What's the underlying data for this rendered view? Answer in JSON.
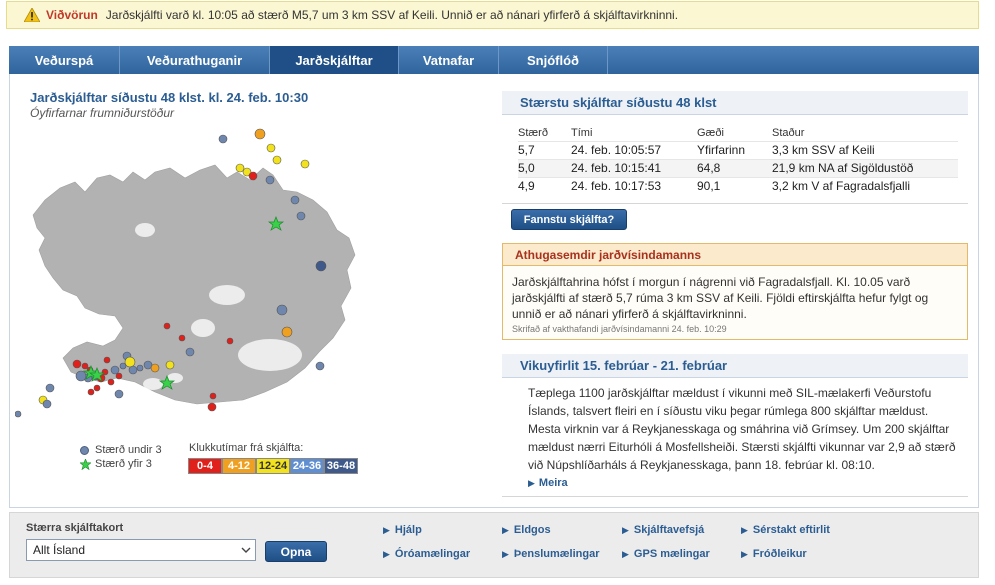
{
  "alert": {
    "label": "Viðvörun",
    "text": "Jarðskjálfti varð kl. 10:05 að stærð M5,7 um 3 km SSV af Keili. Unnið er að nánari yfirferð á skjálftavirkninni."
  },
  "tabs": [
    {
      "label": "Veðurspá",
      "active": false
    },
    {
      "label": "Veðurathuganir",
      "active": false
    },
    {
      "label": "Jarðskjálftar",
      "active": true
    },
    {
      "label": "Vatnafar",
      "active": false
    },
    {
      "label": "Snjóflóð",
      "active": false
    }
  ],
  "map": {
    "title": "Jarðskjálftar síðustu 48 klst.  kl. 24. feb. 10:30",
    "subtitle": "Óyfirfarnar frumniðurstöður",
    "legend": {
      "small_label": "Stærð undir 3",
      "large_label": "Stærð yfir 3",
      "clock_label": "Klukkutímar frá skjálfta:",
      "bins": [
        {
          "label": "0-4",
          "color": "#e0201a"
        },
        {
          "label": "4-12",
          "color": "#f0a020"
        },
        {
          "label": "12-24",
          "color": "#f2e21e"
        },
        {
          "label": "24-36",
          "color": "#5f8fd0"
        },
        {
          "label": "36-48",
          "color": "#3f5a8a"
        }
      ]
    }
  },
  "largest": {
    "title": "Stærstu skjálftar síðustu 48 klst",
    "headers": [
      "Stærð",
      "Tími",
      "Gæði",
      "Staður"
    ],
    "rows": [
      [
        "5,7",
        "24. feb. 10:05:57",
        "Yfirfarinn",
        "3,3 km SSV af Keili"
      ],
      [
        "5,0",
        "24. feb. 10:15:41",
        "64,8",
        "21,9 km NA af Sigöldustöð"
      ],
      [
        "4,9",
        "24. feb. 10:17:53",
        "90,1",
        "3,2 km V af Fagradalsfjalli"
      ]
    ],
    "felt_button": "Fannstu skjálfta?"
  },
  "note": {
    "title": "Athugasemdir jarðvísindamanns",
    "text": "Jarðskjálftahrina hófst í morgun í nágrenni við Fagradalsfjall. Kl. 10.05 varð jarðskjálfti af stærð 5,7 rúma 3 km SSV af Keili. Fjöldi eftirskjálfta hefur fylgt og unnið er að nánari yfirferð á skjálftavirkninni.",
    "signature": "Skrifað af vakthafandi jarðvísindamanni 24. feb. 10:29"
  },
  "weekly": {
    "title": "Vikuyfirlit 15. febrúar - 21. febrúar",
    "text": "Tæplega 1100 jarðskjálftar mældust í vikunni með SIL-mælakerfi Veðurstofu Íslands, talsvert fleiri en í síðustu viku þegar rúmlega 800 skjálftar mældust. Mesta virknin var á Reykjanesskaga og smáhrina við Grímsey. Um 200 skjálftar mældust nærri Eiturhóli á Mosfellsheiði. Stærsti skjálfti vikunnar var 2,9 að stærð við Núpshlíðarháls á Reykjanesskaga, þann 18. febrúar kl. 08:10.",
    "more": "Meira"
  },
  "footer": {
    "map_label": "Stærra skjálftakort",
    "select_value": "Allt Ísland",
    "open_button": "Opna",
    "links": [
      "Hjálp",
      "Eldgos",
      "Skjálftavefsjá",
      "Sérstakt eftirlit",
      "Óróamælingar",
      "Þenslumælingar",
      "GPS mælingar",
      "Fróðleikur"
    ]
  },
  "colors": {
    "accent": "#2b5d93",
    "alert_red": "#c0392b",
    "star": "#3ad04a"
  }
}
